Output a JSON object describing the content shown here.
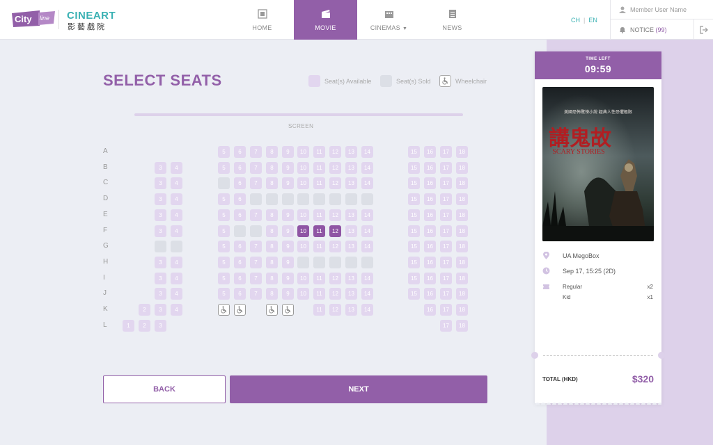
{
  "brand": {
    "cityline": "City line",
    "cineart": "CINEART",
    "cineart_sub": "影藝戲院"
  },
  "nav": {
    "items": [
      {
        "label": "HOME",
        "icon": "film-icon",
        "active": false
      },
      {
        "label": "MOVIE",
        "icon": "clapperboard-icon",
        "active": true
      },
      {
        "label": "CINEMAS",
        "icon": "cinema-building-icon",
        "active": false,
        "dropdown": true
      },
      {
        "label": "NEWS",
        "icon": "news-icon",
        "active": false
      }
    ]
  },
  "lang": {
    "ch": "CH",
    "sep": "|",
    "en": "EN"
  },
  "user": {
    "name": "Member User Name",
    "notice_label": "NOTICE",
    "notice_count": "(99)"
  },
  "page": {
    "title": "SELECT SEATS"
  },
  "legend": {
    "available": "Seat(s) Available",
    "sold": "Seat(s) Sold",
    "wheelchair": "Wheelchair"
  },
  "screen": {
    "label": "SCREEN"
  },
  "seatmap": {
    "rows": [
      "A",
      "B",
      "C",
      "D",
      "E",
      "F",
      "G",
      "H",
      "I",
      "J",
      "K",
      "L"
    ],
    "seats": {
      "A": [
        [
          "5",
          "a"
        ],
        [
          "6",
          "a"
        ],
        [
          "7",
          "a"
        ],
        [
          "8",
          "a"
        ],
        [
          "9",
          "a"
        ],
        [
          "10",
          "a"
        ],
        [
          "11",
          "a"
        ],
        [
          "12",
          "a"
        ],
        [
          "13",
          "a"
        ],
        [
          "14",
          "a"
        ],
        [
          "15",
          "a"
        ],
        [
          "16",
          "a"
        ],
        [
          "17",
          "a"
        ],
        [
          "18",
          "a"
        ]
      ],
      "B": [
        [
          "3",
          "a"
        ],
        [
          "4",
          "a"
        ],
        [
          "5",
          "a"
        ],
        [
          "6",
          "a"
        ],
        [
          "7",
          "a"
        ],
        [
          "8",
          "a"
        ],
        [
          "9",
          "a"
        ],
        [
          "10",
          "a"
        ],
        [
          "11",
          "a"
        ],
        [
          "12",
          "a"
        ],
        [
          "13",
          "a"
        ],
        [
          "14",
          "a"
        ],
        [
          "15",
          "a"
        ],
        [
          "16",
          "a"
        ],
        [
          "17",
          "a"
        ],
        [
          "18",
          "a"
        ]
      ],
      "C": [
        [
          "3",
          "a"
        ],
        [
          "4",
          "a"
        ],
        [
          "5",
          "s"
        ],
        [
          "6",
          "a"
        ],
        [
          "7",
          "a"
        ],
        [
          "8",
          "a"
        ],
        [
          "9",
          "a"
        ],
        [
          "10",
          "a"
        ],
        [
          "11",
          "a"
        ],
        [
          "12",
          "a"
        ],
        [
          "13",
          "a"
        ],
        [
          "14",
          "a"
        ],
        [
          "15",
          "a"
        ],
        [
          "16",
          "a"
        ],
        [
          "17",
          "a"
        ],
        [
          "18",
          "a"
        ]
      ],
      "D": [
        [
          "3",
          "a"
        ],
        [
          "4",
          "a"
        ],
        [
          "5",
          "a"
        ],
        [
          "6",
          "a"
        ],
        [
          "7",
          "s"
        ],
        [
          "8",
          "s"
        ],
        [
          "9",
          "s"
        ],
        [
          "10",
          "s"
        ],
        [
          "11",
          "s"
        ],
        [
          "12",
          "s"
        ],
        [
          "13",
          "s"
        ],
        [
          "14",
          "s"
        ],
        [
          "15",
          "a"
        ],
        [
          "16",
          "a"
        ],
        [
          "17",
          "a"
        ],
        [
          "18",
          "a"
        ]
      ],
      "E": [
        [
          "3",
          "a"
        ],
        [
          "4",
          "a"
        ],
        [
          "5",
          "a"
        ],
        [
          "6",
          "a"
        ],
        [
          "7",
          "a"
        ],
        [
          "8",
          "a"
        ],
        [
          "9",
          "a"
        ],
        [
          "10",
          "a"
        ],
        [
          "11",
          "a"
        ],
        [
          "12",
          "a"
        ],
        [
          "13",
          "a"
        ],
        [
          "14",
          "a"
        ],
        [
          "15",
          "a"
        ],
        [
          "16",
          "a"
        ],
        [
          "17",
          "a"
        ],
        [
          "18",
          "a"
        ]
      ],
      "F": [
        [
          "3",
          "a"
        ],
        [
          "4",
          "a"
        ],
        [
          "5",
          "a"
        ],
        [
          "6",
          "s"
        ],
        [
          "7",
          "s"
        ],
        [
          "8",
          "a"
        ],
        [
          "9",
          "a"
        ],
        [
          "10",
          "x"
        ],
        [
          "11",
          "x"
        ],
        [
          "12",
          "x"
        ],
        [
          "13",
          "a"
        ],
        [
          "14",
          "a"
        ],
        [
          "15",
          "a"
        ],
        [
          "16",
          "a"
        ],
        [
          "17",
          "a"
        ],
        [
          "18",
          "a"
        ]
      ],
      "G": [
        [
          "3",
          "s"
        ],
        [
          "4",
          "s"
        ],
        [
          "5",
          "a"
        ],
        [
          "6",
          "a"
        ],
        [
          "7",
          "a"
        ],
        [
          "8",
          "a"
        ],
        [
          "9",
          "a"
        ],
        [
          "10",
          "a"
        ],
        [
          "11",
          "a"
        ],
        [
          "12",
          "a"
        ],
        [
          "13",
          "a"
        ],
        [
          "14",
          "a"
        ],
        [
          "15",
          "a"
        ],
        [
          "16",
          "a"
        ],
        [
          "17",
          "a"
        ],
        [
          "18",
          "a"
        ]
      ],
      "H": [
        [
          "3",
          "a"
        ],
        [
          "4",
          "a"
        ],
        [
          "5",
          "a"
        ],
        [
          "6",
          "a"
        ],
        [
          "7",
          "a"
        ],
        [
          "8",
          "a"
        ],
        [
          "9",
          "a"
        ],
        [
          "10",
          "s"
        ],
        [
          "11",
          "s"
        ],
        [
          "12",
          "s"
        ],
        [
          "13",
          "s"
        ],
        [
          "14",
          "s"
        ],
        [
          "15",
          "a"
        ],
        [
          "16",
          "a"
        ],
        [
          "17",
          "a"
        ],
        [
          "18",
          "a"
        ]
      ],
      "I": [
        [
          "3",
          "a"
        ],
        [
          "4",
          "a"
        ],
        [
          "5",
          "a"
        ],
        [
          "6",
          "a"
        ],
        [
          "7",
          "a"
        ],
        [
          "8",
          "a"
        ],
        [
          "9",
          "a"
        ],
        [
          "10",
          "a"
        ],
        [
          "11",
          "a"
        ],
        [
          "12",
          "a"
        ],
        [
          "13",
          "a"
        ],
        [
          "14",
          "a"
        ],
        [
          "15",
          "a"
        ],
        [
          "16",
          "a"
        ],
        [
          "17",
          "a"
        ],
        [
          "18",
          "a"
        ]
      ],
      "J": [
        [
          "3",
          "a"
        ],
        [
          "4",
          "a"
        ],
        [
          "5",
          "a"
        ],
        [
          "6",
          "a"
        ],
        [
          "7",
          "a"
        ],
        [
          "8",
          "a"
        ],
        [
          "9",
          "a"
        ],
        [
          "10",
          "a"
        ],
        [
          "11",
          "a"
        ],
        [
          "12",
          "a"
        ],
        [
          "13",
          "a"
        ],
        [
          "14",
          "a"
        ],
        [
          "15",
          "a"
        ],
        [
          "16",
          "a"
        ],
        [
          "17",
          "a"
        ],
        [
          "18",
          "a"
        ]
      ],
      "K": [
        [
          "2",
          "a"
        ],
        [
          "3",
          "a"
        ],
        [
          "4",
          "a"
        ],
        [
          "5",
          "w"
        ],
        [
          "6",
          "w"
        ],
        [
          "8",
          "w"
        ],
        [
          "9",
          "w"
        ],
        [
          "11",
          "a"
        ],
        [
          "12",
          "a"
        ],
        [
          "13",
          "a"
        ],
        [
          "14",
          "a"
        ],
        [
          "16",
          "a"
        ],
        [
          "17",
          "a"
        ],
        [
          "18",
          "a"
        ]
      ],
      "L": [
        [
          "1",
          "a"
        ],
        [
          "2",
          "a"
        ],
        [
          "3",
          "a"
        ],
        [
          "17",
          "a"
        ],
        [
          "18",
          "a"
        ]
      ]
    }
  },
  "buttons": {
    "back": "BACK",
    "next": "NEXT"
  },
  "ticket": {
    "time_left_label": "TIME LEFT",
    "time_left": "09:59",
    "poster_cn_line": "美國恐怖驚悚小說 經典人性恐懼極限",
    "poster_title_cn": "講鬼故",
    "poster_title_en": "SCARY STORIES",
    "cinema": "UA MegoBox",
    "datetime": "Sep 17, 15:25 (2D)",
    "tickets": [
      {
        "type": "Regular",
        "qty": "x2"
      },
      {
        "type": "Kid",
        "qty": "x1"
      }
    ],
    "total_label": "TOTAL (HKD)",
    "total_value": "$320"
  },
  "colors": {
    "accent": "#925fa8",
    "available": "#e2d6ef",
    "sold": "#dcdfe6",
    "teal": "#3ab1b3"
  }
}
